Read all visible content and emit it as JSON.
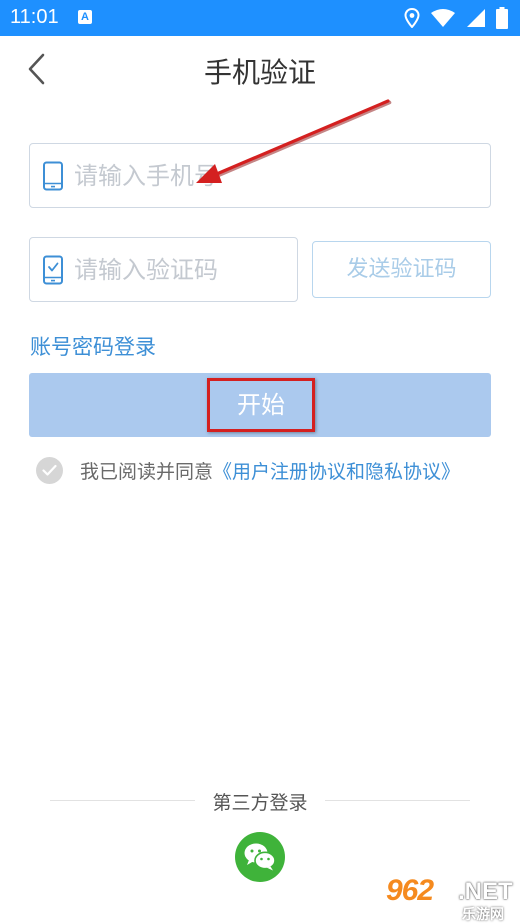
{
  "status_bar": {
    "time": "11:01",
    "app_indicator": "A",
    "icons": [
      "location-icon",
      "wifi-icon",
      "signal-icon",
      "battery-icon"
    ],
    "background": "#1e90ff"
  },
  "header": {
    "title": "手机验证",
    "back_icon": "chevron-left-icon"
  },
  "form": {
    "phone_placeholder": "请输入手机号",
    "phone_value": "",
    "code_placeholder": "请输入验证码",
    "code_value": "",
    "send_code_label": "发送验证码",
    "account_login_label": "账号密码登录",
    "start_label": "开始"
  },
  "agreement": {
    "text": "我已阅读并同意",
    "link": "《用户注册协议和隐私协议》",
    "checked": true
  },
  "third_party": {
    "label": "第三方登录",
    "providers": [
      "wechat-icon"
    ]
  },
  "watermark": {
    "number": "962",
    "suffix": ".NET",
    "sub": "乐游网"
  },
  "colors": {
    "accent": "#3d8fd6",
    "start_button": "#abc9ee",
    "annotation_red": "#d42020",
    "wechat_green": "#3fb33a"
  }
}
